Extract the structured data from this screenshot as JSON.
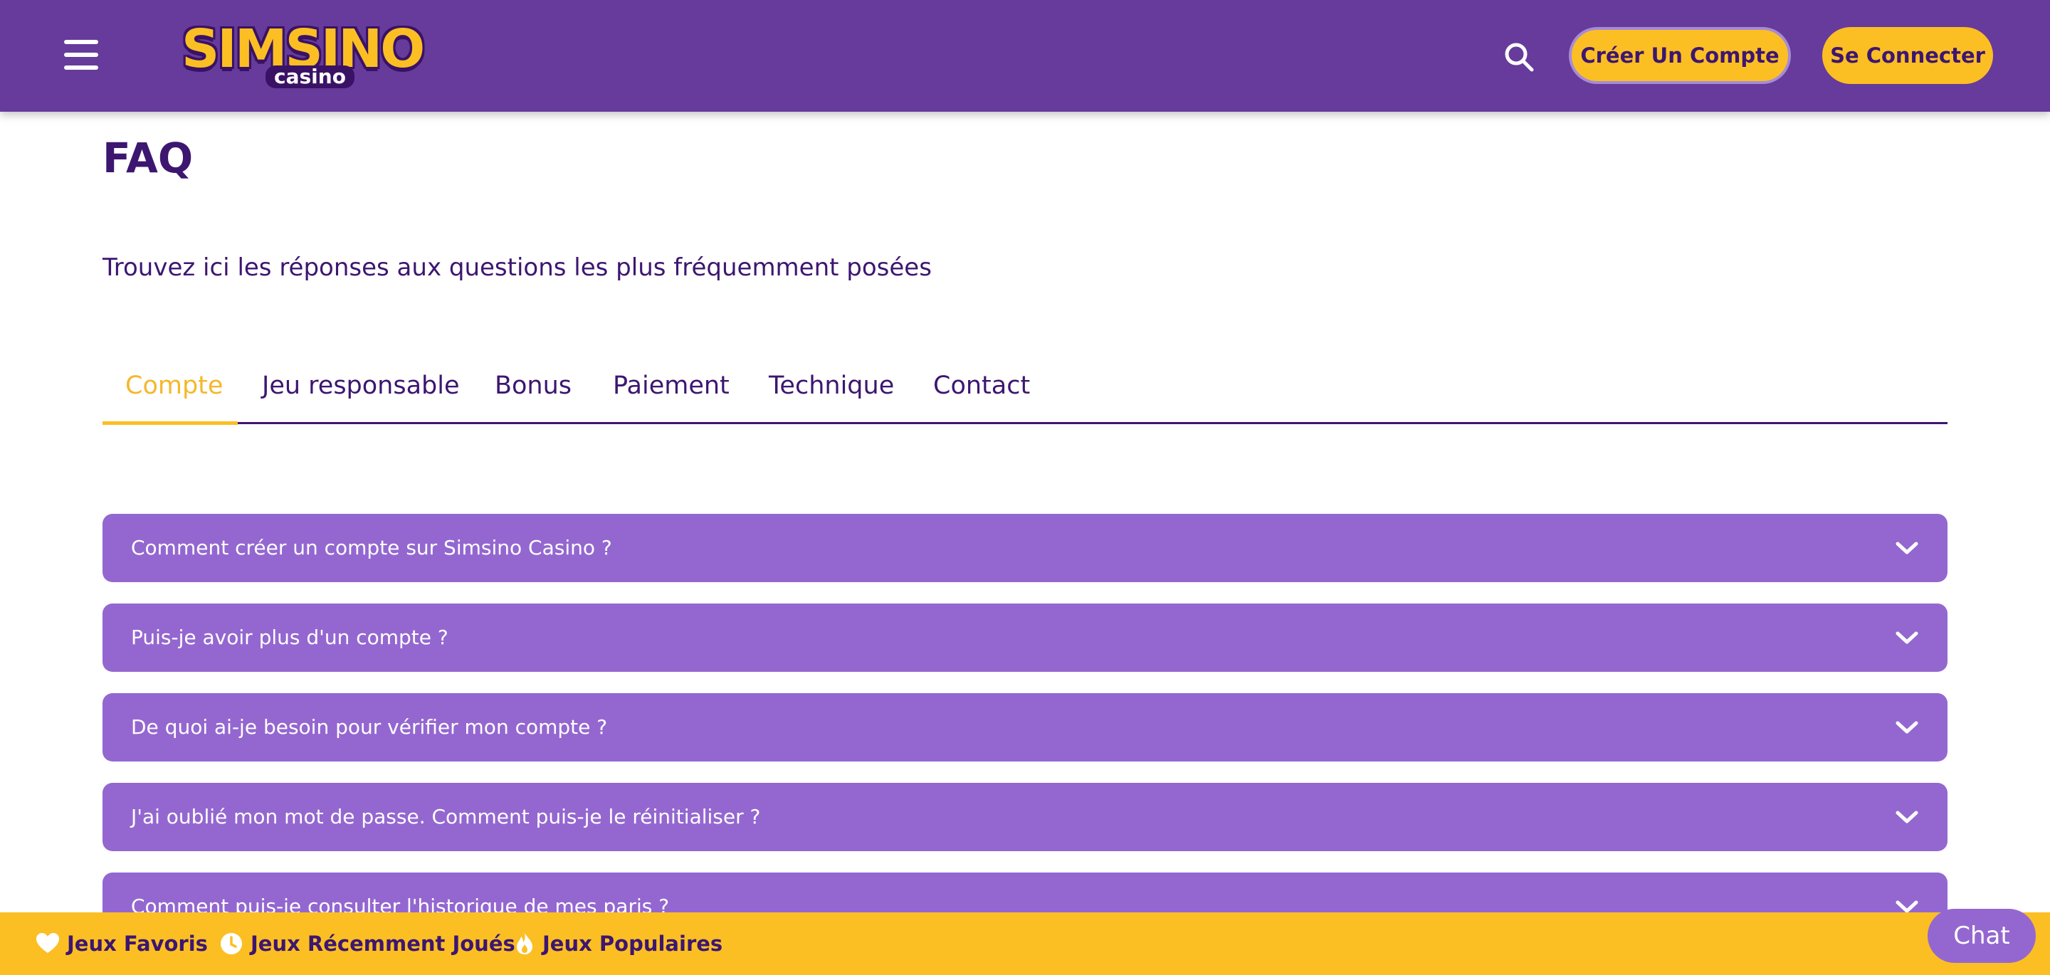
{
  "header": {
    "logo_text": "SIMSINO",
    "logo_subtext": "casino",
    "create_account_label": "Créer Un Compte",
    "login_label": "Se Connecter",
    "menu_icon": "hamburger-menu-icon",
    "search_icon": "search-icon"
  },
  "main": {
    "title": "FAQ",
    "subtitle": "Trouvez ici les réponses aux questions les plus fréquemment posées",
    "tabs": [
      {
        "label": "Compte",
        "active": true
      },
      {
        "label": "Jeu responsable",
        "active": false
      },
      {
        "label": "Bonus",
        "active": false
      },
      {
        "label": "Paiement",
        "active": false
      },
      {
        "label": "Technique",
        "active": false
      },
      {
        "label": "Contact",
        "active": false
      }
    ],
    "faq_items": [
      {
        "question": "Comment créer un compte sur Simsino Casino ?"
      },
      {
        "question": "Puis-je avoir plus d'un compte ?"
      },
      {
        "question": "De quoi ai-je besoin pour vérifier mon compte ?"
      },
      {
        "question": "J'ai oublié mon mot de passe. Comment puis-je le réinitialiser ?"
      },
      {
        "question": "Comment puis-je consulter l'historique de mes paris ?"
      }
    ]
  },
  "bottom_bar": {
    "items": [
      {
        "label": "Jeux Favoris",
        "icon": "heart-icon"
      },
      {
        "label": "Jeux Récemment Joués",
        "icon": "clock-icon"
      },
      {
        "label": "Jeux Populaires",
        "icon": "flame-icon"
      }
    ]
  },
  "chat": {
    "label": "Chat"
  },
  "colors": {
    "header_bg": "#663b9b",
    "accent_yellow": "#fbbf24",
    "faq_bg": "#9467d0",
    "text_dark_purple": "#3d1670"
  }
}
